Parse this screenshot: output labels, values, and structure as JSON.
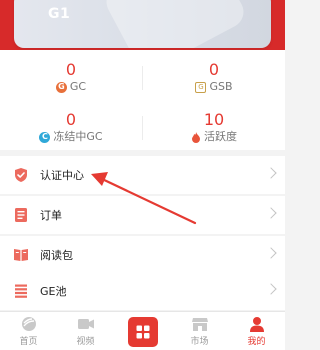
{
  "header": {
    "level_label": "G1"
  },
  "stats": [
    {
      "value": "0",
      "label": "GC",
      "icon": "gc-icon"
    },
    {
      "value": "0",
      "label": "GSB",
      "icon": "gsb-icon"
    },
    {
      "value": "0",
      "label": "冻结中GC",
      "icon": "frozen-gc-icon"
    },
    {
      "value": "10",
      "label": "活跃度",
      "icon": "flame-icon"
    }
  ],
  "menu": [
    {
      "label": "认证中心",
      "icon": "shield-check-icon"
    },
    {
      "label": "订单",
      "icon": "order-list-icon"
    },
    {
      "label": "阅读包",
      "icon": "book-icon"
    },
    {
      "label": "GE池",
      "icon": "pool-icon"
    }
  ],
  "bottom_nav": [
    {
      "label": "首页",
      "icon": "home-icon"
    },
    {
      "label": "视频",
      "icon": "video-icon"
    },
    {
      "label": "",
      "icon": "app-grid-icon"
    },
    {
      "label": "市场",
      "icon": "market-icon"
    },
    {
      "label": "我的",
      "icon": "profile-icon"
    }
  ],
  "colors": {
    "accent": "#e53a32",
    "header": "#d72a2a"
  }
}
